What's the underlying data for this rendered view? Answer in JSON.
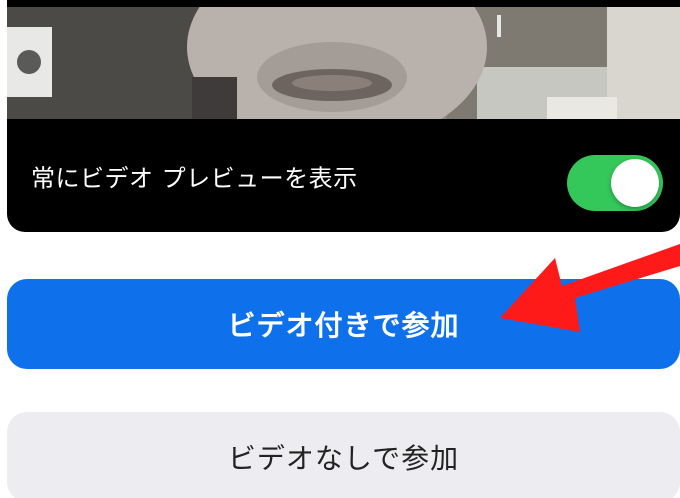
{
  "preview": {
    "toggle_label": "常にビデオ プレビューを表示",
    "toggle_state": "on"
  },
  "buttons": {
    "join_with_video": "ビデオ付きで参加",
    "join_without_video": "ビデオなしで参加"
  },
  "colors": {
    "primary_button": "#0e71eb",
    "secondary_button": "#ececf1",
    "toggle_on": "#34c759",
    "annotation_arrow": "#ff1a1a"
  }
}
